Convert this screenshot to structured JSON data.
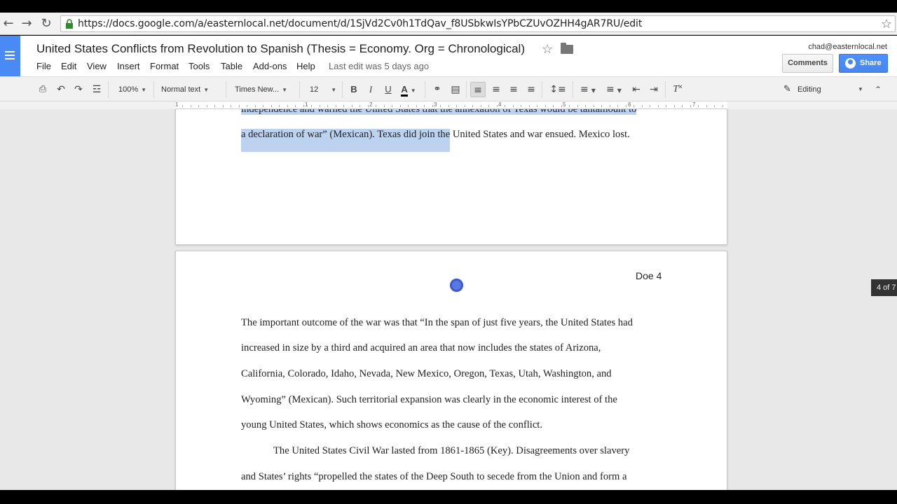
{
  "browser": {
    "url": "https://docs.google.com/a/easternlocal.net/document/d/1SjVd2Cv0h1TdQav_f8USbkwIsYPbCZUvOZHH4gAR7RU/edit"
  },
  "header": {
    "title": "United States Conflicts from Revolution to Spanish (Thesis = Economy. Org = Chronological)",
    "user_email": "chad@easternlocal.net",
    "comments_label": "Comments",
    "share_label": "Share",
    "last_edit": "Last edit was 5 days ago"
  },
  "menu": [
    "File",
    "Edit",
    "View",
    "Insert",
    "Format",
    "Tools",
    "Table",
    "Add-ons",
    "Help"
  ],
  "toolbar": {
    "zoom": "100%",
    "style": "Normal text",
    "font": "Times New...",
    "size": "12",
    "text_color_label": "A",
    "editing_label": "Editing",
    "icons": [
      "print-icon",
      "undo-icon",
      "redo-icon",
      "paint-format-icon",
      "bold-icon",
      "italic-icon",
      "underline-icon",
      "text-color-icon",
      "link-icon",
      "comment-icon",
      "align-left-icon",
      "align-center-icon",
      "align-right-icon",
      "align-justify-icon",
      "line-spacing-icon",
      "numbered-list-icon",
      "bulleted-list-icon",
      "decrease-indent-icon",
      "increase-indent-icon",
      "clear-formatting-icon",
      "pencil-icon",
      "collapse-icon"
    ]
  },
  "ruler": {
    "numbers": [
      "1",
      "1",
      "2",
      "3",
      "4",
      "5",
      "6",
      "7"
    ]
  },
  "document": {
    "page_top_lines": [
      "independence and warned the United States that the annexation of Texas would be tantamount to",
      "a declaration of war” (Mexican). Texas did join the United States and war ensued. Mexico lost."
    ],
    "page_top_line2_selected": "a declaration of war” (Mexican). Texas did join the",
    "page_top_line2_rest": " United States and war ensued. Mexico lost.",
    "page_header": "Doe 4",
    "page_lines": [
      "The important outcome of the war was that “In the span of just five years, the United States had",
      "increased in size by a third and acquired an area that now includes the states of Arizona,",
      "California, Colorado, Idaho, Nevada, New Mexico, Oregon, Texas, Utah, Washington, and",
      "Wyoming” (Mexican). Such territorial expansion was clearly in the economic interest of the",
      "young United States, which shows economics as the cause of the conflict.",
      "The United States Civil War lasted from 1861-1865 (Key). Disagreements over slavery",
      "and States’ rights “propelled the states of the Deep South to secede from the Union and form a"
    ]
  },
  "page_counter": "4 of 7",
  "colors": {
    "accent": "#4d90fe",
    "selection": "#bcd2ee",
    "docs_logo": "#4a8af4"
  }
}
